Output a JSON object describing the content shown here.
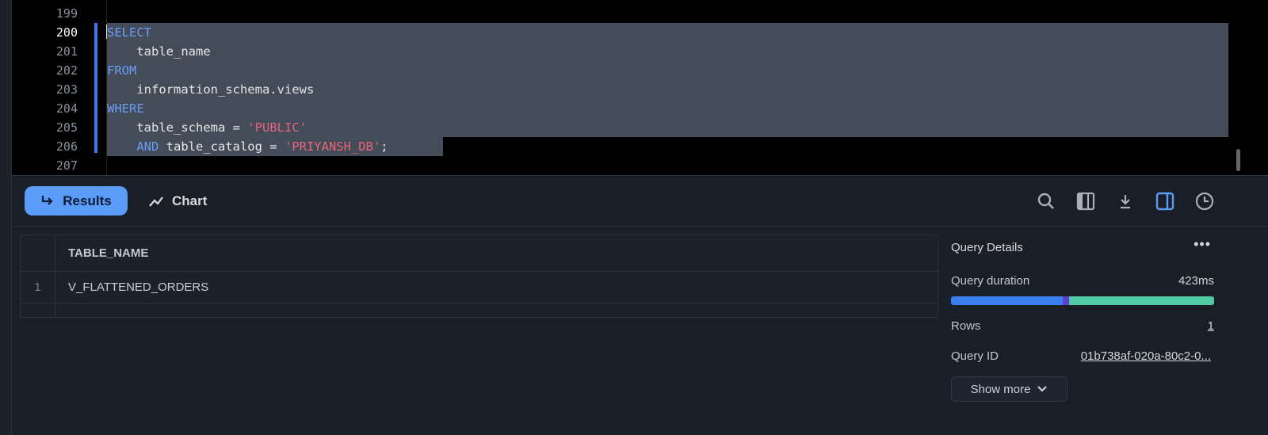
{
  "editor": {
    "lines": [
      {
        "num": "199",
        "tokens": []
      },
      {
        "num": "200",
        "tokens": [
          {
            "t": "SELECT",
            "c": "kw"
          }
        ]
      },
      {
        "num": "201",
        "tokens": [
          {
            "t": "    table_name",
            "c": ""
          }
        ]
      },
      {
        "num": "202",
        "tokens": [
          {
            "t": "FROM",
            "c": "kw"
          }
        ]
      },
      {
        "num": "203",
        "tokens": [
          {
            "t": "    information_schema.views",
            "c": ""
          }
        ]
      },
      {
        "num": "204",
        "tokens": [
          {
            "t": "WHERE",
            "c": "kw"
          }
        ]
      },
      {
        "num": "205",
        "tokens": [
          {
            "t": "    table_schema = ",
            "c": ""
          },
          {
            "t": "'PUBLIC'",
            "c": "str"
          }
        ]
      },
      {
        "num": "206",
        "tokens": [
          {
            "t": "    ",
            "c": ""
          },
          {
            "t": "AND",
            "c": "kw"
          },
          {
            "t": " table_catalog = ",
            "c": ""
          },
          {
            "t": "'PRIYANSH_DB'",
            "c": "str"
          },
          {
            "t": ";",
            "c": ""
          }
        ]
      },
      {
        "num": "207",
        "tokens": []
      }
    ],
    "active_line": "200"
  },
  "toolbar": {
    "results_label": "Results",
    "chart_label": "Chart",
    "icons": [
      "search-icon",
      "columns-icon",
      "download-icon",
      "split-view-icon",
      "history-icon"
    ],
    "accent": "#5a9cf8"
  },
  "table": {
    "columns": [
      "TABLE_NAME"
    ],
    "rows": [
      {
        "index": "1",
        "values": [
          "V_FLATTENED_ORDERS"
        ]
      }
    ]
  },
  "details": {
    "title": "Query Details",
    "duration_label": "Query duration",
    "duration_value": "423ms",
    "duration_breakdown": [
      {
        "fraction": 0.425,
        "color": "#3b7fee"
      },
      {
        "fraction": 0.025,
        "color": "#5b3fd0"
      },
      {
        "fraction": 0.55,
        "color": "#4fcaa3"
      }
    ],
    "rows_label": "Rows",
    "rows_value": "1",
    "query_id_label": "Query ID",
    "query_id_value": "01b738af-020a-80c2-0...",
    "show_more": "Show more"
  }
}
